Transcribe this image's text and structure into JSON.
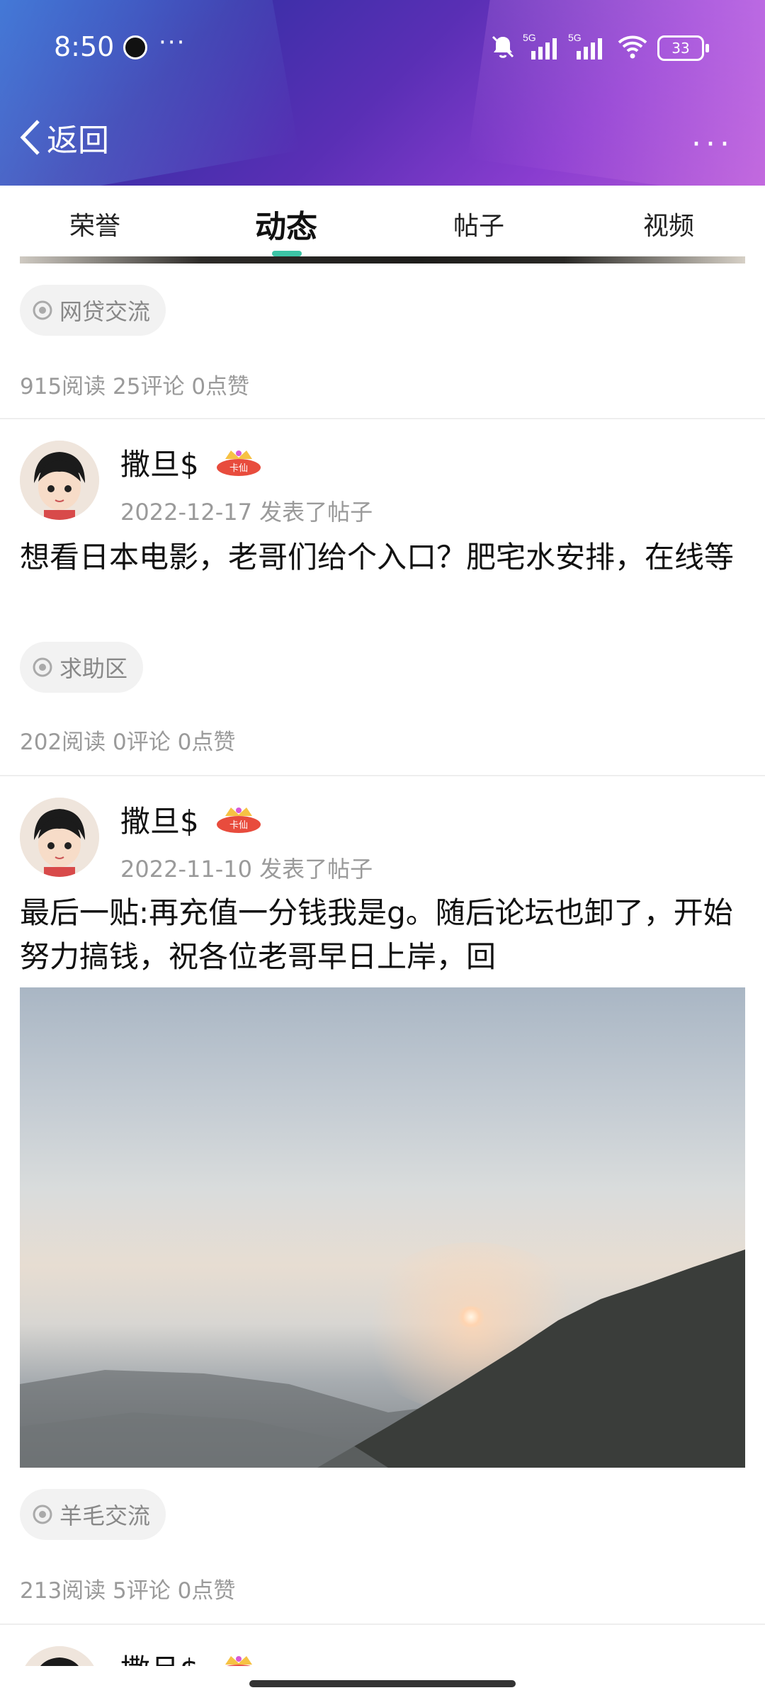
{
  "status_bar": {
    "time": "8:50",
    "dots": "···",
    "battery": "33",
    "network": [
      "5G",
      "5G"
    ]
  },
  "nav": {
    "back_label": "返回",
    "more_label": "···"
  },
  "tabs": [
    {
      "label": "荣誉"
    },
    {
      "label": "动态"
    },
    {
      "label": "帖子"
    },
    {
      "label": "视频"
    }
  ],
  "active_tab": 1,
  "feed": {
    "top_item": {
      "topic": "网贷交流",
      "stats": "915阅读 25评论 0点赞"
    },
    "posts": [
      {
        "user": "撒旦$",
        "badge_text": "卡仙",
        "date_action": "2022-12-17  发表了帖子",
        "text": "想看日本电影，老哥们给个入口？肥宅水安排，在线等",
        "topic": "求助区",
        "stats": "202阅读 0评论 0点赞"
      },
      {
        "user": "撒旦$",
        "badge_text": "卡仙",
        "date_action": "2022-11-10  发表了帖子",
        "text": "最后一贴:再充值一分钱我是g。随后论坛也卸了，开始努力搞钱，祝各位老哥早日上岸，回",
        "topic": "羊毛交流",
        "stats": "213阅读 5评论 0点赞"
      },
      {
        "user": "撒旦$",
        "badge_text": "卡仙"
      }
    ]
  },
  "colors": {
    "accent": "#3cc4a6",
    "header_start": "#1d3db8",
    "header_end": "#b45ad7",
    "muted_text": "#9a9a9a"
  }
}
